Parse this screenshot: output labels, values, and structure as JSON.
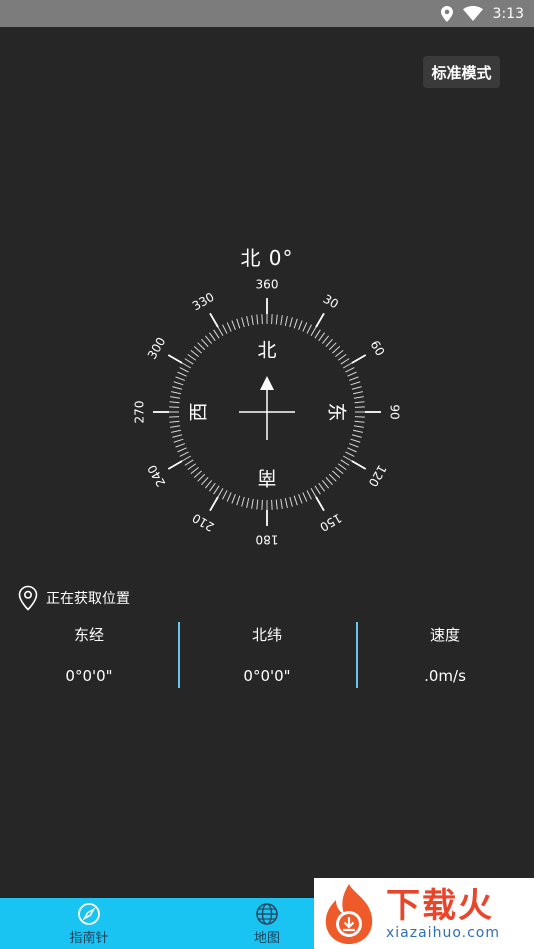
{
  "status_bar": {
    "time": "3:13"
  },
  "mode_button": {
    "label": "标准模式"
  },
  "heading": {
    "readout": "北 0°"
  },
  "compass": {
    "degree_labels": [
      "360",
      "30",
      "60",
      "90",
      "120",
      "150",
      "180",
      "210",
      "240",
      "270",
      "300",
      "330"
    ],
    "directions": {
      "north": "北",
      "east": "东",
      "south": "南",
      "west": "西"
    }
  },
  "location": {
    "status": "正在获取位置"
  },
  "info": [
    {
      "label": "东经",
      "value": "0°0'0\""
    },
    {
      "label": "北纬",
      "value": "0°0'0\""
    },
    {
      "label": "速度",
      "value": ".0m/s"
    }
  ],
  "nav": [
    {
      "label": "指南针"
    },
    {
      "label": "地图"
    }
  ],
  "watermark": {
    "main": "下载火",
    "sub": "xiazaihuo.com"
  },
  "colors": {
    "background": "#262626",
    "accent": "#19c4f3",
    "divider": "#66c7ee"
  }
}
